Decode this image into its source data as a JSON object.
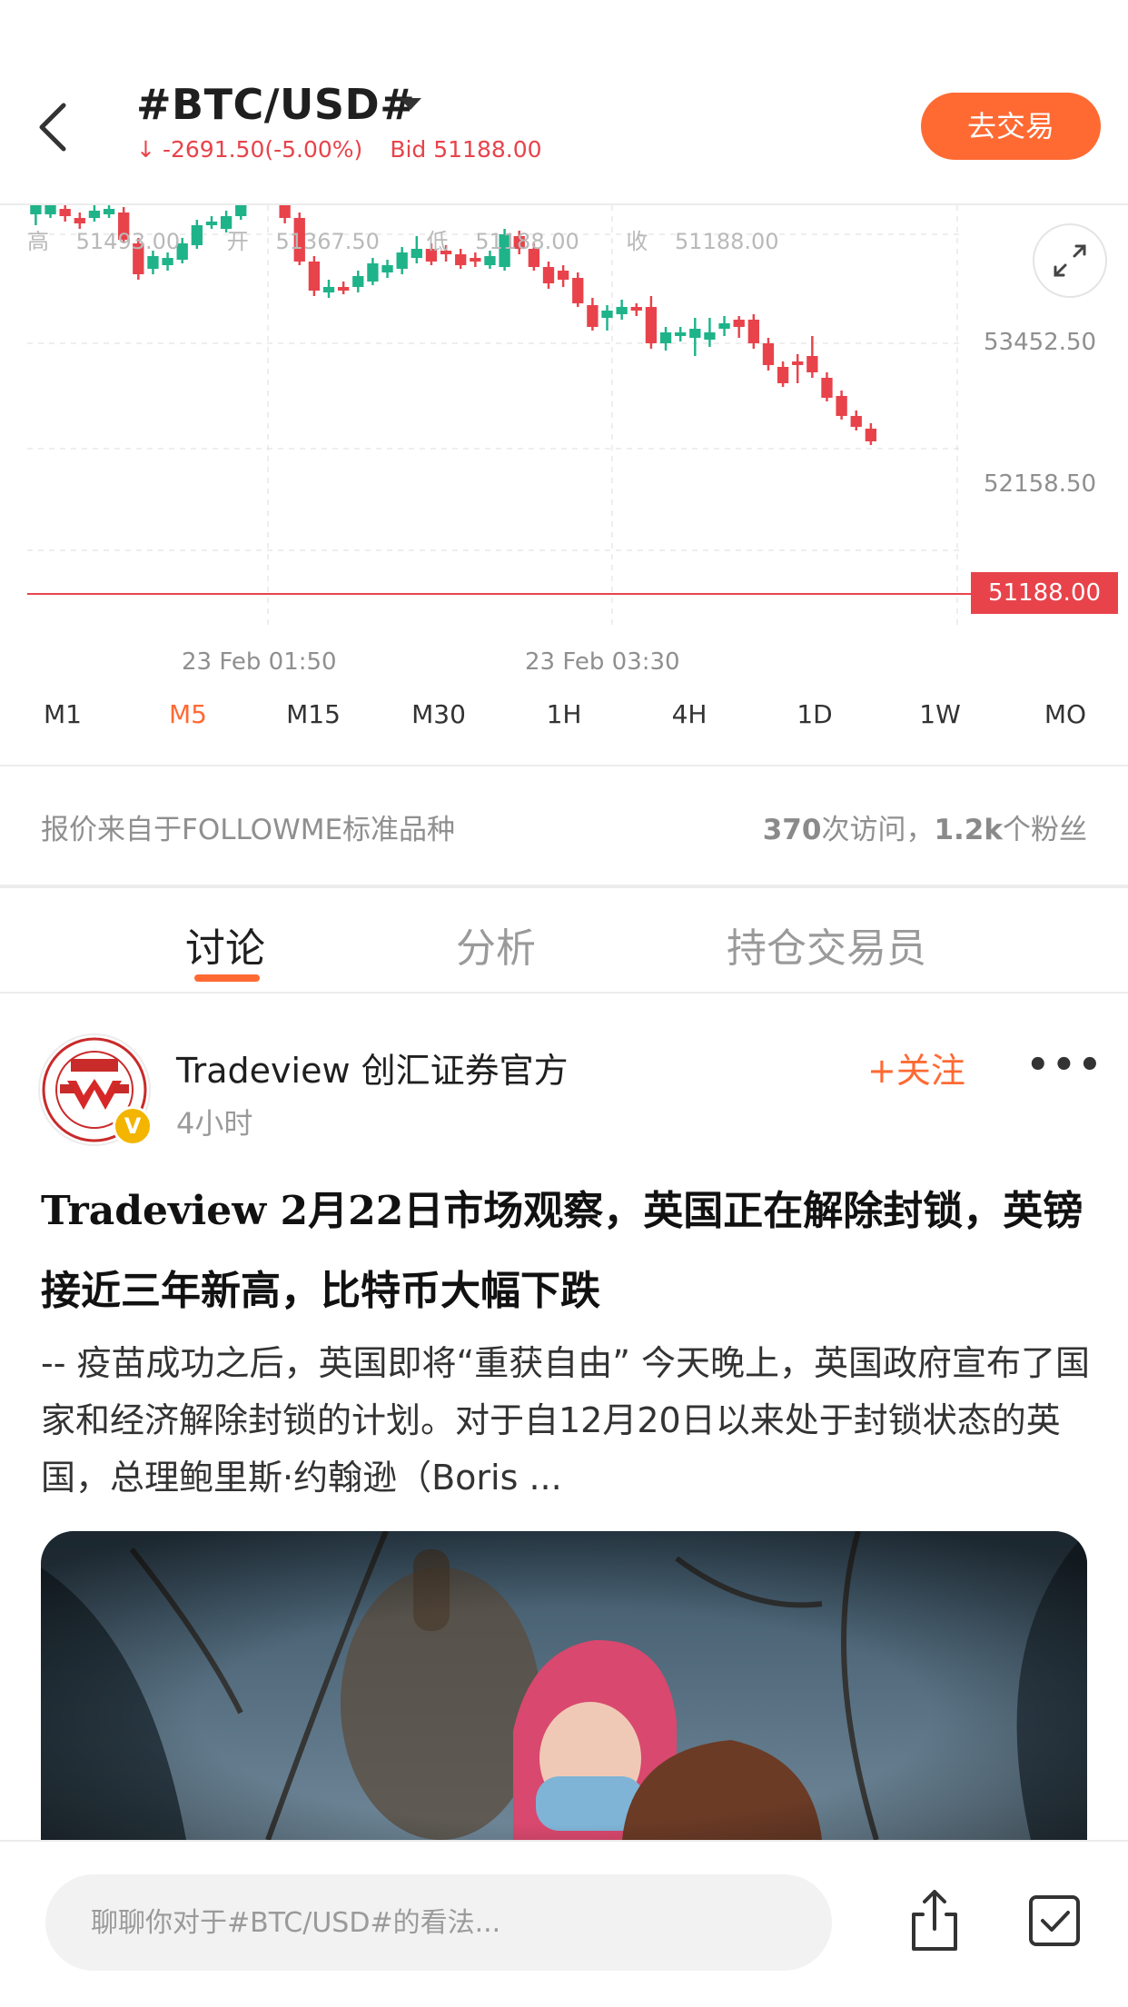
{
  "header": {
    "symbol": "#BTC/USD#",
    "change_arrow": "↓",
    "change": "-2691.50(-5.00%)",
    "bid_label": "Bid",
    "bid_value": "51188.00",
    "trade_button": "去交易"
  },
  "chart": {
    "ohlc": {
      "high_label": "高",
      "high": "51493.00",
      "open_label": "开",
      "open": "51367.50",
      "low_label": "低",
      "low": "51188.00",
      "close_label": "收",
      "close": "51188.00"
    },
    "price_levels": [
      "53452.50",
      "52158.50"
    ],
    "last_price": "51188.00",
    "time_labels": [
      "23 Feb 01:50",
      "23 Feb 03:30"
    ],
    "colors": {
      "up": "#1fb38a",
      "down": "#e8434b",
      "last_line": "#e8434b"
    }
  },
  "timeframes": [
    "M1",
    "M5",
    "M15",
    "M30",
    "1H",
    "4H",
    "1D",
    "1W",
    "MO"
  ],
  "active_timeframe": "M5",
  "source": {
    "text": "报价来自于FOLLOWME标准品种",
    "visits": "370",
    "visits_label": "次访问，",
    "fans": "1.2k",
    "fans_label": "个粉丝"
  },
  "tabs": [
    "讨论",
    "分析",
    "持仓交易员"
  ],
  "active_tab": "讨论",
  "post": {
    "author": "Tradeview 创汇证券官方",
    "time": "4小时",
    "follow_label": "+关注",
    "more_label": "•••",
    "verified_label": "V",
    "title": "Tradeview 2月22日市场观察，英国正在解除封锁，英镑接近三年新高，比特币大幅下跌",
    "excerpt": "-- 疫苗成功之后，英国即将“重获自由” 今天晚上，英国政府宣布了国家和经济解除封锁的计划。对于自12月20日以来处于封锁状态的英国，总理鲍里斯·约翰逊（Boris ..."
  },
  "bottom_bar": {
    "comment_placeholder": "聊聊你对于#BTC/USD#的看法..."
  },
  "icons": [
    "back-icon",
    "dropdown-caret-icon",
    "expand-icon",
    "share-icon",
    "checkbox-icon",
    "verified-icon"
  ],
  "accent_color": "#ff6a33"
}
